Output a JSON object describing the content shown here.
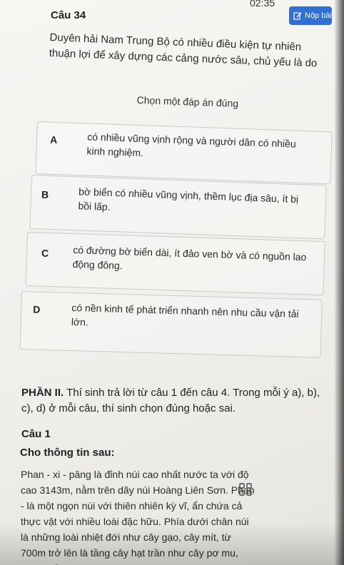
{
  "status": {
    "clock": "02:35"
  },
  "header": {
    "submit_label": "Nộp bài"
  },
  "question34": {
    "title": "Câu 34",
    "text": "Duyên hải Nam Trung Bộ có nhiều điều kiện tự nhiên thuận lợi để xây dựng các cảng nước sâu, chủ yếu là do",
    "instruction": "Chọn một đáp án đúng",
    "options": [
      {
        "letter": "A",
        "text": "có nhiều vũng vịnh rộng và người dân có nhiều kinh nghiệm."
      },
      {
        "letter": "B",
        "text": "bờ biển có nhiều vũng vịnh, thềm lục địa sâu, ít bị bồi lấp."
      },
      {
        "letter": "C",
        "text": "có đường bờ biển dài, ít đảo ven bờ và có nguồn lao động đông."
      },
      {
        "letter": "D",
        "text": "có nền kinh tế phát triển nhanh nên nhu cầu vận tải lớn."
      }
    ]
  },
  "part2": {
    "heading": "PHẦN II.",
    "text": "Thí sinh trả lời từ câu 1 đến câu 4. Trong mỗi ý a), b), c), d) ở mỗi câu, thí sinh chọn đúng hoặc sai."
  },
  "question1": {
    "title": "Câu 1",
    "info_label": "Cho thông tin sau:",
    "passage": "Phan - xi - păng là đỉnh núi cao nhất nước ta với độ cao 3143m, nằm trên dãy núi Hoàng Liên Sơn. Phan - là một ngọn núi với thiên nhiên kỳ vĩ, ẩn chứa cả thực vật với nhiều loài đặc hữu. Phía dưới chân núi là những loài nhiệt đới như cây gạo, cây mít, từ 700m trở lên là tầng cây hạt trần như cây pơ mu, thông đỏ,...Lên cao"
  },
  "icons": {
    "submit": "edit-icon",
    "grid": "grid-icon"
  }
}
